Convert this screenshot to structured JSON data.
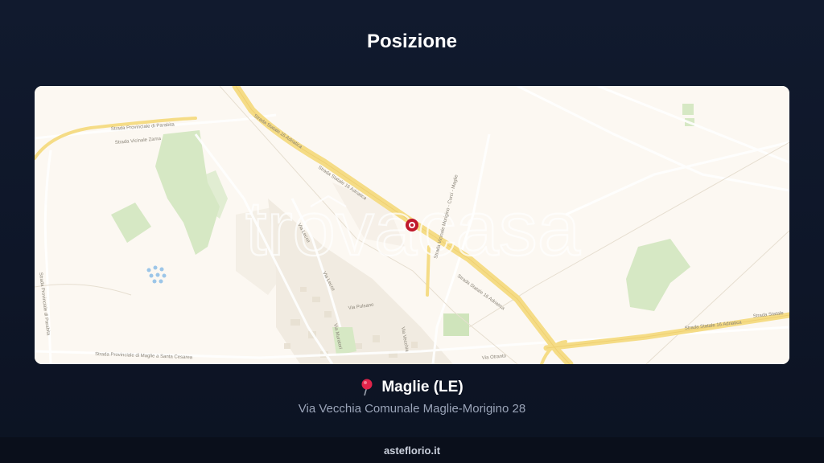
{
  "page": {
    "title": "Posizione"
  },
  "map": {
    "watermark": "trovacasa",
    "labels": {
      "sp_parabita": "Strada Provinciale di Parabita",
      "vicinale_zama": "Strada Vicinale Zama",
      "ss16_a": "Strada Statale 16 Adriatica",
      "ss16_b": "Strada Statale 16 Adriatica",
      "ss16_c": "Strada Statale 16 Adriatica",
      "ss16_d": "Strada Statale 16 Adriatica",
      "ss16_e": "Strada Statale",
      "via_lecce": "Via Lecce",
      "via_lecce_2": "Via Lecce",
      "via_pulsano": "Via Pulsano",
      "via_muratori": "Via Muratori",
      "sp_parabita_v": "Strada Provinciale di Parabita",
      "sp_maglie_cesarea": "Strada Provinciale di Maglie a Santa Cesarea",
      "vicinale_morigino": "Strada Vicinale Morigino - Curci - Maglie",
      "via_otranto": "Via Otranto",
      "via_vecchia": "Via Vecchia"
    },
    "colors": {
      "land": "#fcf8f2",
      "road_major": "#f5dc86",
      "park": "#d6e8c4",
      "marker": "#c0192c"
    }
  },
  "location": {
    "city": "Maglie (LE)",
    "address": "Via Vecchia Comunale Maglie-Morigino 28",
    "icon": "red-pushpin-icon"
  },
  "footer": {
    "site": "asteflorio.it"
  }
}
